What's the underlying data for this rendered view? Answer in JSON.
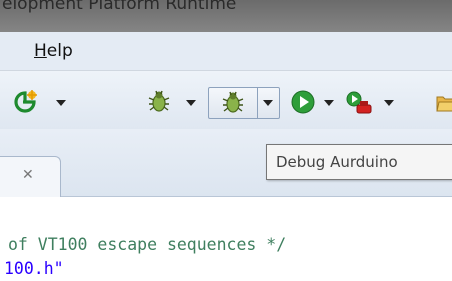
{
  "window": {
    "title": "elopment Platform Runtime"
  },
  "menubar": {
    "help_mnemonic": "H",
    "help_rest": "elp"
  },
  "toolbar": {
    "icons": [
      "new-wizard-icon",
      "debug-bug-icon",
      "debug-bug-icon",
      "run-icon",
      "external-tools-icon",
      "open-folder-icon"
    ],
    "tooltip": "Debug Aurduino"
  },
  "tab": {
    "close_glyph": "✕"
  },
  "editor": {
    "line1": "of VT100 escape sequences */",
    "line2": "100.h\""
  },
  "colors": {
    "comment": "#3f7f5f",
    "string": "#2a00ff",
    "run_green": "#2e9e3a",
    "menu_bg": "#e4ebf4"
  }
}
